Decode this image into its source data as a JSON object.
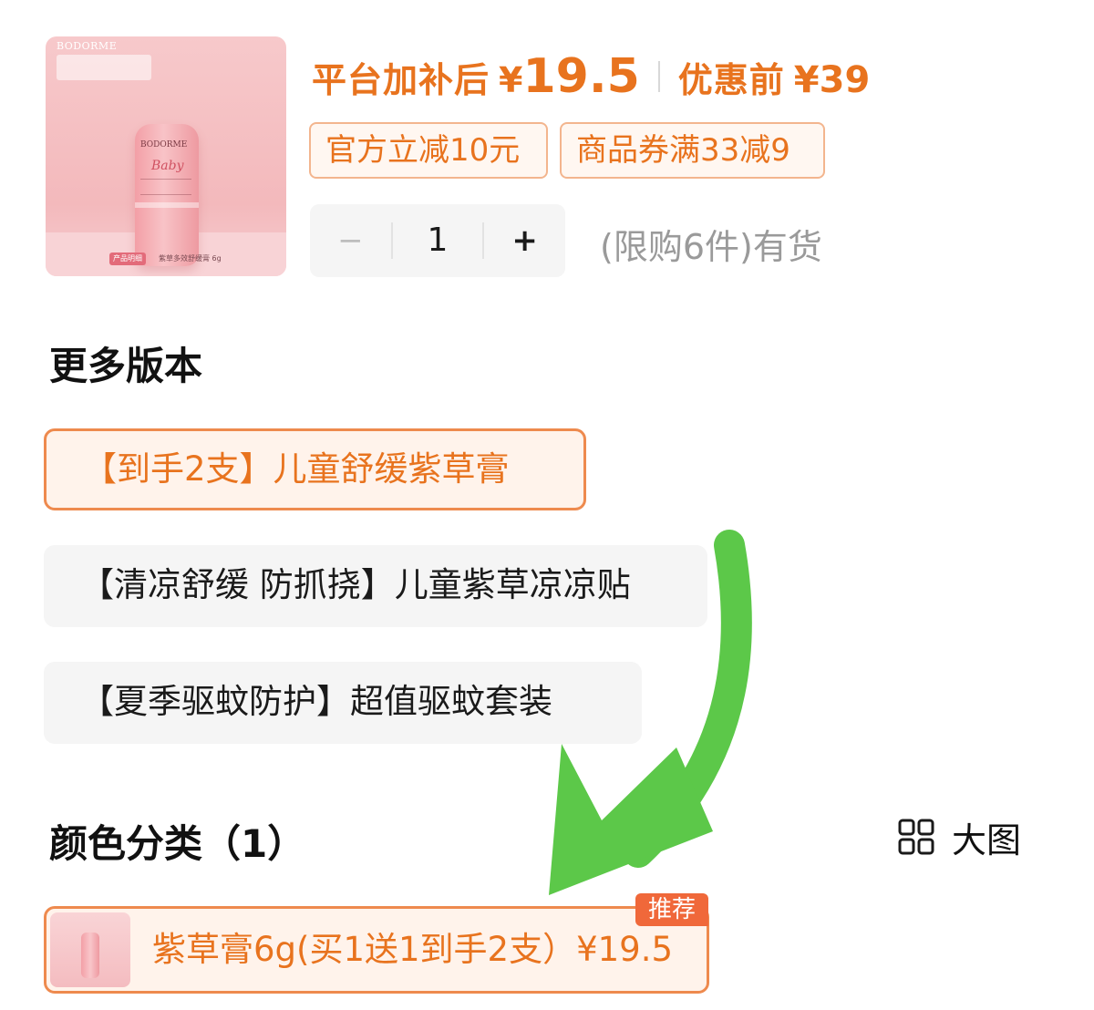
{
  "product": {
    "thumbnail": {
      "brand_top": "BODORME",
      "stick_brand": "BODORME",
      "stick_script": "Baby",
      "badge": "产品明细",
      "caption": "紫草多效舒缓膏 6g"
    }
  },
  "price": {
    "after_subsidy_label": "平台加补后",
    "currency": "¥",
    "after_subsidy_value": "19.5",
    "before_discount_label": "优惠前",
    "before_discount_value": "¥39"
  },
  "coupons": [
    {
      "label": "官方立减10元"
    },
    {
      "label": "商品券满33减9"
    }
  ],
  "quantity": {
    "minus": "−",
    "value": "1",
    "plus": "+",
    "stock_note": "(限购6件)有货"
  },
  "versions": {
    "title": "更多版本",
    "options": [
      {
        "label": "【到手2支】儿童舒缓紫草膏",
        "selected": true
      },
      {
        "label": "【清凉舒缓 防抓挠】儿童紫草凉凉贴",
        "selected": false
      },
      {
        "label": "【夏季驱蚊防护】超值驱蚊套装",
        "selected": false
      }
    ]
  },
  "colors": {
    "title": "颜色分类（1）",
    "view_toggle": {
      "icon": "grid-icon",
      "label": "大图"
    },
    "options": [
      {
        "label": "紫草膏6g(买1送1到手2支）¥19.5",
        "badge": "推荐",
        "selected": true
      }
    ]
  },
  "theme": {
    "accent": "#e8731e",
    "selected_border": "#ee8a4e",
    "selected_bg": "#fff3eb",
    "badge_bg": "#f0683a",
    "annotation_arrow": "#5cc849"
  }
}
